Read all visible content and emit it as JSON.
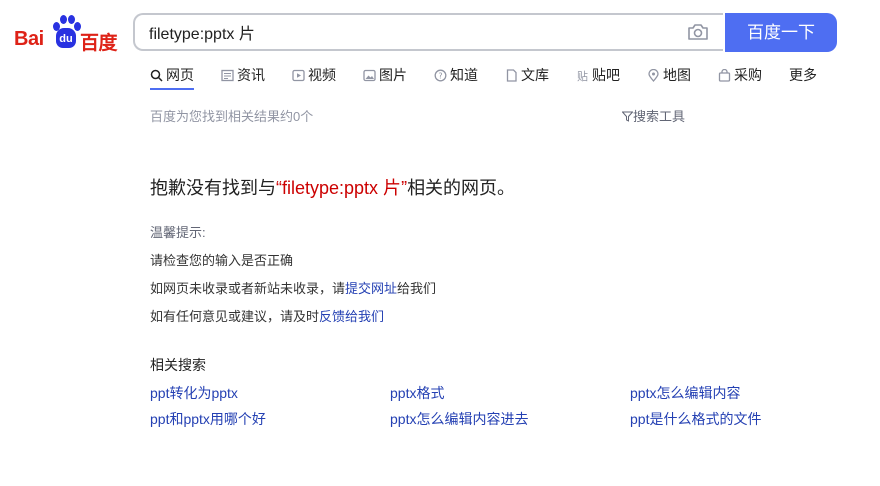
{
  "logo": {
    "left_text": "Bai",
    "paw_text": "du",
    "right_text": "百度"
  },
  "search": {
    "value": "filetype:pptx 片",
    "button_label": "百度一下"
  },
  "tabs": [
    {
      "icon": "search-icon",
      "label": "网页"
    },
    {
      "icon": "news-icon",
      "label": "资讯"
    },
    {
      "icon": "video-icon",
      "label": "视频"
    },
    {
      "icon": "image-icon",
      "label": "图片"
    },
    {
      "icon": "question-icon",
      "label": "知道"
    },
    {
      "icon": "document-icon",
      "label": "文库"
    },
    {
      "icon": "tieba-icon",
      "label": "贴吧"
    },
    {
      "icon": "map-icon",
      "label": "地图"
    },
    {
      "icon": "shopping-icon",
      "label": "采购"
    },
    {
      "icon": "",
      "label": "更多"
    }
  ],
  "result_count": "百度为您找到相关结果约0个",
  "search_tools_label": "搜索工具",
  "not_found": {
    "prefix": "抱歉没有找到与",
    "open_quote": "“",
    "query": "filetype:pptx 片",
    "close_quote": "”",
    "suffix": "相关的网页。"
  },
  "tips": {
    "title": "温馨提示:",
    "line1": "请检查您的输入是否正确",
    "line2_prefix": "如网页未收录或者新站未收录，请",
    "line2_link": "提交网址",
    "line2_suffix": "给我们",
    "line3_prefix": "如有任何意见或建议，请及时",
    "line3_link": "反馈给我们"
  },
  "related": {
    "title": "相关搜索",
    "items": [
      "ppt转化为pptx",
      "pptx格式",
      "pptx怎么编辑内容",
      "ppt和pptx用哪个好",
      "pptx怎么编辑内容进去",
      "ppt是什么格式的文件"
    ]
  },
  "colors": {
    "brand_blue": "#4e6ef2",
    "logo_red": "#de2217",
    "paw_blue": "#2932e1",
    "link_blue": "#2440b3",
    "query_red": "#cc0000"
  }
}
